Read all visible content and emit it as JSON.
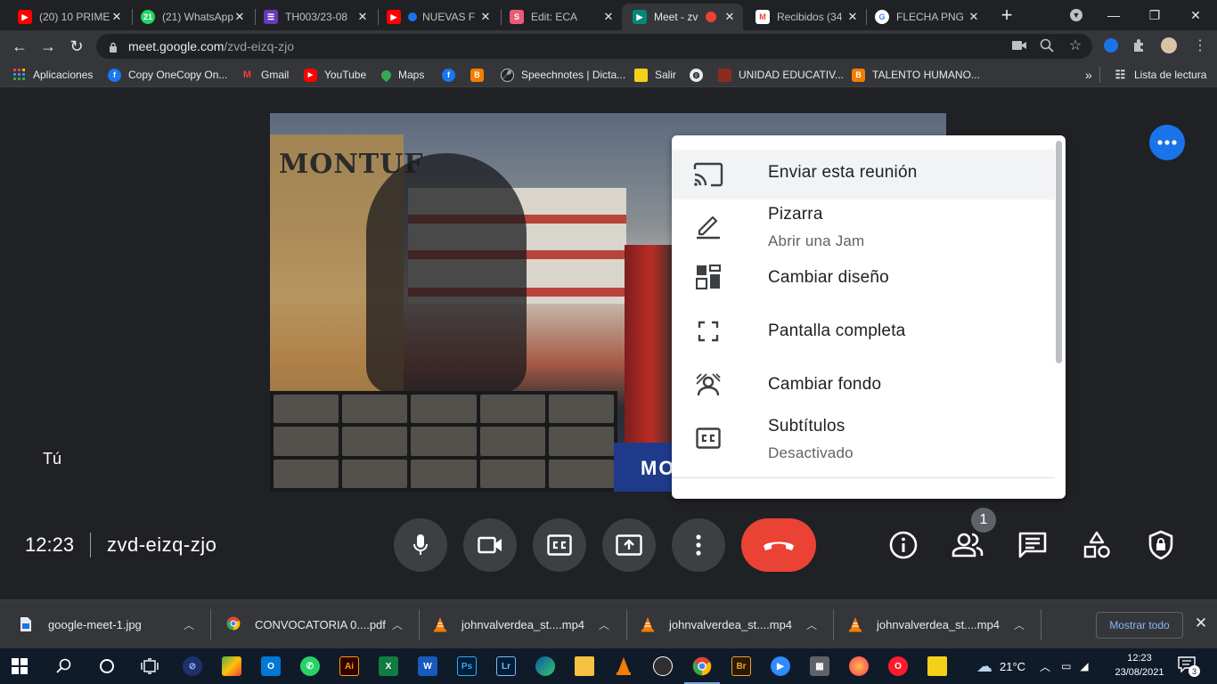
{
  "browser": {
    "tabs": [
      {
        "label": "(20) 10 PRIME",
        "icon": "youtube-icon",
        "color": "#ff0000"
      },
      {
        "label": "(21) WhatsApp",
        "icon": "whatsapp-icon",
        "color": "#25d366"
      },
      {
        "label": "TH003/23-08",
        "icon": "forms-icon",
        "color": "#673ab7"
      },
      {
        "label": "NUEVAS F",
        "icon": "youtube-icon",
        "color": "#ff0000"
      },
      {
        "label": "Edit: ECA",
        "icon": "sway-icon",
        "color": "#e85d75"
      },
      {
        "label": "Meet - zv",
        "icon": "meet-icon",
        "color": "#00897b"
      },
      {
        "label": "Recibidos (34",
        "icon": "gmail-icon",
        "color": "#ea4335"
      },
      {
        "label": "FLECHA PNG",
        "icon": "google-icon",
        "color": "#4285f4"
      }
    ],
    "url_host": "meet.google.com",
    "url_path": "/zvd-eizq-zjo"
  },
  "bookmarks": [
    {
      "label": "Aplicaciones",
      "icon": "apps-grid-icon",
      "color": "#4285f4"
    },
    {
      "label": "Copy OneCopy On...",
      "icon": "facebook-icon",
      "color": "#1877f2"
    },
    {
      "label": "Gmail",
      "icon": "gmail-icon",
      "color": "#ea4335"
    },
    {
      "label": "YouTube",
      "icon": "youtube-icon",
      "color": "#ff0000"
    },
    {
      "label": "Maps",
      "icon": "maps-icon",
      "color": "#34a853"
    },
    {
      "label": "",
      "icon": "facebook-icon",
      "color": "#1877f2"
    },
    {
      "label": "",
      "icon": "blogger-icon",
      "color": "#f57d00"
    },
    {
      "label": "Speechnotes | Dicta...",
      "icon": "microphone-icon",
      "color": "#202124"
    },
    {
      "label": "Salir",
      "icon": "sticky-note-icon",
      "color": "#f4d01a"
    },
    {
      "label": "",
      "icon": "globe-icon",
      "color": "#e8eaed"
    },
    {
      "label": "UNIDAD EDUCATIV...",
      "icon": "school-icon",
      "color": "#8d2b1f"
    },
    {
      "label": "TALENTO HUMANO...",
      "icon": "blogger-icon",
      "color": "#f57d00"
    }
  ],
  "reading_list": "Lista de lectura",
  "meet": {
    "self_label": "Tú",
    "time": "12:23",
    "code": "zvd-eizq-zjo",
    "participants_count": "1",
    "video_banner_text": "MONTUF",
    "video_footer_text": "MOS",
    "menu": [
      {
        "label": "Enviar esta reunión",
        "sub": "",
        "icon": "cast-icon"
      },
      {
        "label": "Pizarra",
        "sub": "Abrir una Jam",
        "icon": "pencil-icon"
      },
      {
        "label": "Cambiar diseño",
        "sub": "",
        "icon": "layout-icon"
      },
      {
        "label": "Pantalla completa",
        "sub": "",
        "icon": "fullscreen-icon"
      },
      {
        "label": "Cambiar fondo",
        "sub": "",
        "icon": "background-icon"
      },
      {
        "label": "Subtítulos",
        "sub": "Desactivado",
        "icon": "captions-icon"
      }
    ],
    "accent_color": "#1a73e8",
    "hangup_color": "#ea4335"
  },
  "downloads": {
    "items": [
      {
        "name": "google-meet-1.jpg",
        "icon": "file-icon"
      },
      {
        "name": "CONVOCATORIA 0....pdf",
        "icon": "chrome-pdf-icon"
      },
      {
        "name": "johnvalverdea_st....mp4",
        "icon": "vlc-icon"
      },
      {
        "name": "johnvalverdea_st....mp4",
        "icon": "vlc-icon"
      },
      {
        "name": "johnvalverdea_st....mp4",
        "icon": "vlc-icon"
      }
    ],
    "show_all": "Mostrar todo"
  },
  "taskbar": {
    "apps": [
      {
        "icon": "search-icon",
        "label": ""
      },
      {
        "icon": "cortana-icon",
        "label": ""
      },
      {
        "icon": "task-view-icon",
        "label": ""
      },
      {
        "icon": "app-icon",
        "label": ""
      },
      {
        "icon": "bluestacks-icon",
        "label": ""
      },
      {
        "icon": "outlook-icon",
        "label": "O"
      },
      {
        "icon": "whatsapp-icon",
        "label": ""
      },
      {
        "icon": "illustrator-icon",
        "label": "Ai"
      },
      {
        "icon": "excel-icon",
        "label": "X"
      },
      {
        "icon": "word-icon",
        "label": "W"
      },
      {
        "icon": "photoshop-icon",
        "label": "Ps"
      },
      {
        "icon": "lightroom-icon",
        "label": "Lr"
      },
      {
        "icon": "edge-icon",
        "label": ""
      },
      {
        "icon": "file-explorer-icon",
        "label": ""
      },
      {
        "icon": "vlc-icon",
        "label": ""
      },
      {
        "icon": "obs-icon",
        "label": ""
      },
      {
        "icon": "chrome-icon",
        "label": ""
      },
      {
        "icon": "bridge-icon",
        "label": "Br"
      },
      {
        "icon": "zoom-icon",
        "label": ""
      },
      {
        "icon": "calculator-icon",
        "label": ""
      },
      {
        "icon": "firefox-icon",
        "label": ""
      },
      {
        "icon": "opera-icon",
        "label": ""
      },
      {
        "icon": "sticky-notes-icon",
        "label": ""
      }
    ],
    "weather": "21°C",
    "time": "12:23",
    "date": "23/08/2021",
    "notifications": "3"
  }
}
